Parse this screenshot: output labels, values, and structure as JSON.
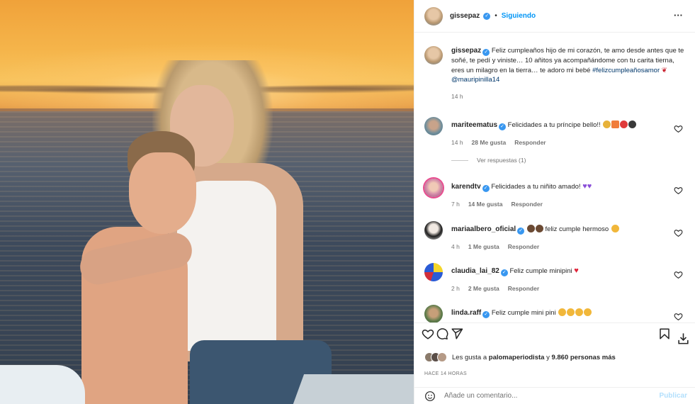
{
  "post": {
    "author": "gissepaz",
    "follow_status": "Siguiendo",
    "more_icon": "more-options-icon"
  },
  "caption": {
    "author": "gissepaz",
    "text": "Feliz cumpleaños hijo de mi corazón, te amo desde antes que te soñé, te pedí y viniste… 10 añitos ya acompañándome con tu carita tierna, eres un milagro en la tierra… te adoro mi bebé",
    "hashtag": "#felizcumpleañosamor",
    "mention": "@mauripinilla14",
    "time": "14 h"
  },
  "comments": [
    {
      "user": "mariteematus",
      "text": "Felicidades a tu príncipe bello!!",
      "time": "14 h",
      "likes": "28 Me gusta",
      "reply": "Responder",
      "view_replies": "Ver respuestas (1)"
    },
    {
      "user": "karendtv",
      "text": "Felicidades a tu niñito amado!",
      "time": "7 h",
      "likes": "14 Me gusta",
      "reply": "Responder"
    },
    {
      "user": "mariaalbero_oficial",
      "text": "feliz cumple hermoso",
      "time": "4 h",
      "likes": "1 Me gusta",
      "reply": "Responder"
    },
    {
      "user": "claudia_lai_82",
      "text": "Feliz cumple minipini",
      "time": "2 h",
      "likes": "2 Me gusta",
      "reply": "Responder"
    },
    {
      "user": "linda.raff",
      "text": "Feliz cumple mini pini"
    }
  ],
  "likes_summary": {
    "prefix": "Les gusta a",
    "user": "palomaperiodista",
    "joiner": "y",
    "others": "9.860 personas más"
  },
  "posted_ago": "HACE 14 HORAS",
  "add_comment": {
    "placeholder": "Añade un comentario...",
    "publish": "Publicar"
  },
  "colors": {
    "accent": "#0095f6",
    "verified": "#3897f0",
    "muted": "#737373",
    "link": "#00376b"
  }
}
